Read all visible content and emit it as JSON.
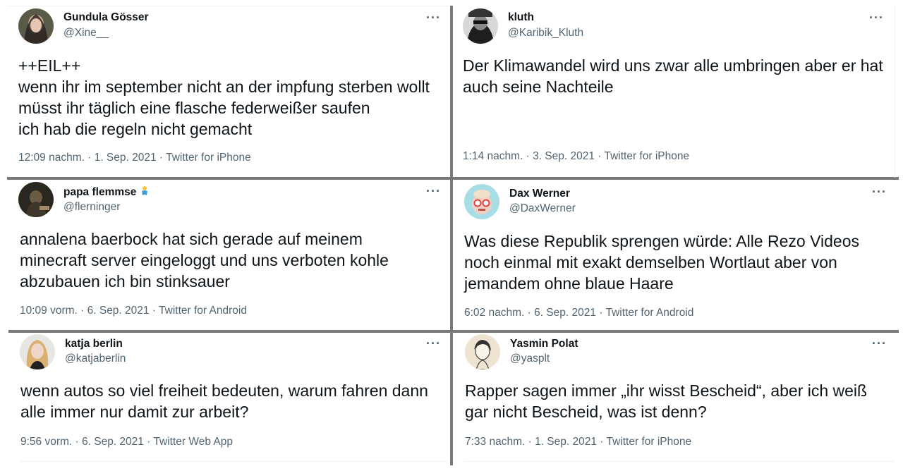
{
  "tweets": [
    {
      "name": "Gundula Gösser",
      "handle": "@Xine__",
      "text": "++EIL++\nwenn ihr im september nicht an der impfung sterben wollt müsst ihr täglich eine flasche federweißer saufen\nich hab die regeln nicht gemacht",
      "meta": "12:09 nachm. · 1. Sep. 2021 · Twitter for iPhone",
      "more": "···"
    },
    {
      "name": "kluth",
      "handle": "@Karibik_Kluth",
      "text": "Der Klimawandel wird uns zwar alle umbringen aber er hat auch seine Nachteile",
      "meta": "1:14 nachm. · 3. Sep. 2021 · Twitter for iPhone",
      "more": "···"
    },
    {
      "name": "papa flemmse",
      "handle": "@flerninger",
      "text": "annalena baerbock hat sich gerade auf meinem minecraft server eingeloggt und uns verboten kohle abzubauen ich bin stinksauer",
      "meta": "10:09 vorm. · 6. Sep. 2021 · Twitter for Android",
      "more": "···"
    },
    {
      "name": "Dax Werner",
      "handle": "@DaxWerner",
      "text": "Was diese Republik sprengen würde: Alle Rezo Videos noch einmal mit exakt demselben Wortlaut aber von jemandem ohne blaue Haare",
      "meta": "6:02 nachm. · 6. Sep. 2021 · Twitter for Android",
      "more": "···"
    },
    {
      "name": "katja berlin",
      "handle": "@katjaberlin",
      "text": "wenn autos so viel freiheit bedeuten, warum fahren dann alle immer nur damit zur arbeit?",
      "meta": "9:56 vorm. · 6. Sep. 2021 · Twitter Web App",
      "more": "···"
    },
    {
      "name": "Yasmin Polat",
      "handle": "@yasplt",
      "text": "Rapper sagen immer „ihr wisst Bescheid“, aber ich weiß gar nicht Bescheid, was ist denn?",
      "meta": "7:33 nachm. · 1. Sep. 2021 · Twitter for iPhone",
      "more": "···"
    }
  ]
}
